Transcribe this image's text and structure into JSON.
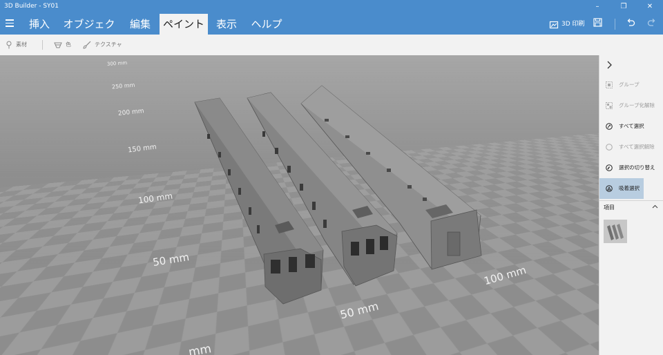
{
  "window": {
    "title": "3D Builder - SY01",
    "controls": [
      "–",
      "❐",
      "✕"
    ]
  },
  "menu": {
    "tabs": [
      "挿入",
      "オブジェクト",
      "編集",
      "ペイント",
      "表示",
      "ヘルプ"
    ],
    "active": "ペイント",
    "print_label": "3D 印刷"
  },
  "ribbon": {
    "material": "素材",
    "color": "色",
    "texture": "テクスチャ"
  },
  "viewport": {
    "rulers_left": [
      "300 mm",
      "250 mm",
      "200 mm",
      "150 mm",
      "100 mm",
      "50 mm",
      "mm"
    ],
    "rulers_bottom": [
      "50 mm",
      "100 mm"
    ]
  },
  "panel": {
    "items": [
      {
        "label": "グループ",
        "state": "disabled",
        "icon": "group-icon"
      },
      {
        "label": "グループ化解除",
        "state": "disabled",
        "icon": "ungroup-icon"
      },
      {
        "label": "すべて選択",
        "state": "enabled",
        "icon": "select-all-icon"
      },
      {
        "label": "すべて選択解除",
        "state": "disabled",
        "icon": "deselect-all-icon"
      },
      {
        "label": "選択の切り替え",
        "state": "enabled",
        "icon": "toggle-selection-icon"
      },
      {
        "label": "吸着選択",
        "state": "selected",
        "icon": "snap-select-icon"
      }
    ],
    "section_title": "項目"
  },
  "colors": {
    "accent": "#4a8ccc",
    "toolbar_bg": "#f2f2f2",
    "selected_item": "#b8cde0"
  }
}
